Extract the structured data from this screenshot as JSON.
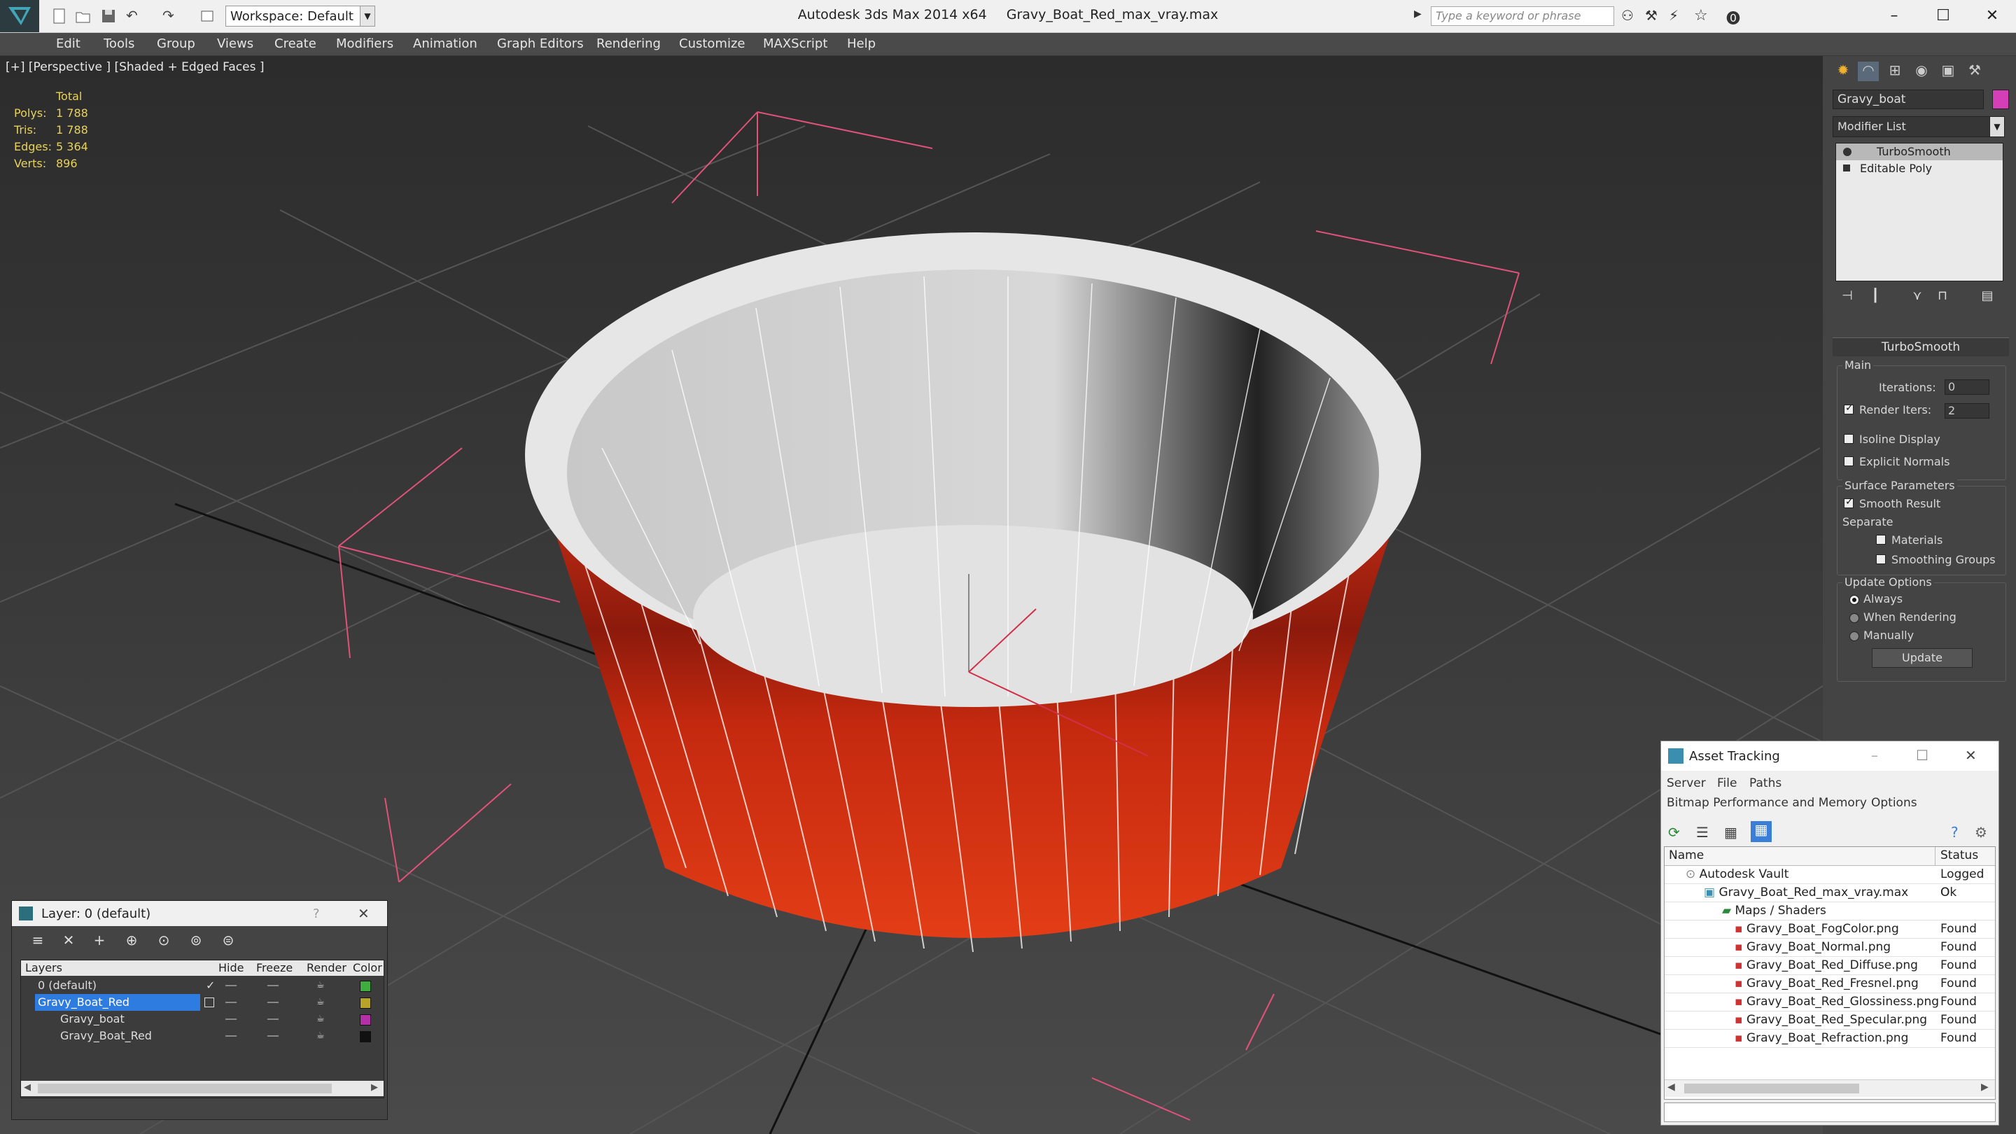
{
  "titlebar": {
    "app": "Autodesk 3ds Max  2014 x64",
    "file": "Gravy_Boat_Red_max_vray.max",
    "workspace": "Workspace: Default",
    "search_placeholder": "Type a keyword or phrase"
  },
  "menu": [
    "Edit",
    "Tools",
    "Group",
    "Views",
    "Create",
    "Modifiers",
    "Animation",
    "Graph Editors",
    "Rendering",
    "Customize",
    "MAXScript",
    "Help"
  ],
  "viewport": {
    "label": "[+] [Perspective ] [Shaded + Edged Faces ]",
    "stats_header": "Total",
    "stats": [
      {
        "k": "Polys:",
        "v": "1 788"
      },
      {
        "k": "Tris:",
        "v": "1 788"
      },
      {
        "k": "Edges:",
        "v": "5 364"
      },
      {
        "k": "Verts:",
        "v": "896"
      }
    ]
  },
  "command_panel": {
    "object_name": "Gravy_boat",
    "object_color": "#d43fb7",
    "modifier_list": "Modifier List",
    "stack": [
      "TurboSmooth",
      "Editable Poly"
    ],
    "rollout_title": "TurboSmooth",
    "main_label": "Main",
    "iterations_label": "Iterations:",
    "iterations_value": "0",
    "render_iters_label": "Render Iters:",
    "render_iters_value": "2",
    "isoline": "Isoline Display",
    "explicit_normals": "Explicit Normals",
    "surface_params": "Surface Parameters",
    "smooth_result": "Smooth Result",
    "separate": "Separate",
    "materials": "Materials",
    "smoothing_groups": "Smoothing Groups",
    "update_options": "Update Options",
    "always": "Always",
    "when_rendering": "When Rendering",
    "manually": "Manually",
    "update_button": "Update"
  },
  "asset_tracking": {
    "title": "Asset Tracking",
    "menu1": [
      "Server",
      "File",
      "Paths"
    ],
    "menu2": [
      "Bitmap Performance and Memory",
      "Options"
    ],
    "col_name": "Name",
    "col_status": "Status",
    "rows": [
      {
        "name": "Autodesk Vault",
        "status": "Logged O",
        "indent": 0
      },
      {
        "name": "Gravy_Boat_Red_max_vray.max",
        "status": "Ok",
        "indent": 1
      },
      {
        "name": "Maps / Shaders",
        "status": "",
        "indent": 2
      },
      {
        "name": "Gravy_Boat_FogColor.png",
        "status": "Found",
        "indent": 3
      },
      {
        "name": "Gravy_Boat_Normal.png",
        "status": "Found",
        "indent": 3
      },
      {
        "name": "Gravy_Boat_Red_Diffuse.png",
        "status": "Found",
        "indent": 3
      },
      {
        "name": "Gravy_Boat_Red_Fresnel.png",
        "status": "Found",
        "indent": 3
      },
      {
        "name": "Gravy_Boat_Red_Glossiness.png",
        "status": "Found",
        "indent": 3
      },
      {
        "name": "Gravy_Boat_Red_Specular.png",
        "status": "Found",
        "indent": 3
      },
      {
        "name": "Gravy_Boat_Refraction.png",
        "status": "Found",
        "indent": 3
      }
    ]
  },
  "layers": {
    "title": "Layer: 0 (default)",
    "help": "?",
    "cols": [
      "Layers",
      "Hide",
      "Freeze",
      "Render",
      "Color"
    ],
    "rows": [
      {
        "name": "0 (default)",
        "color": "#3fae3f",
        "sel": false,
        "indent": 0
      },
      {
        "name": "Gravy_Boat_Red",
        "color": "#b7a22a",
        "sel": true,
        "indent": 0
      },
      {
        "name": "Gravy_boat",
        "color": "#b52fa6",
        "sel": false,
        "indent": 1
      },
      {
        "name": "Gravy_Boat_Red",
        "color": "#111111",
        "sel": false,
        "indent": 1
      }
    ]
  }
}
